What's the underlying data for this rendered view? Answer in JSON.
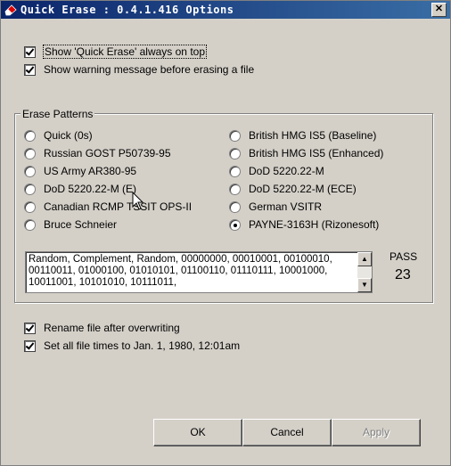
{
  "window": {
    "title": "Quick Erase : 0.4.1.416 Options",
    "close_glyph": "✕"
  },
  "options_top": [
    {
      "label": "Show 'Quick Erase' always on top",
      "checked": true
    },
    {
      "label": "Show warning message before erasing a file",
      "checked": true
    }
  ],
  "patterns": {
    "group_label": "Erase Patterns",
    "left": [
      "Quick (0s)",
      "Russian GOST P50739-95",
      "US Army AR380-95",
      "DoD 5220.22-M (E)",
      "Canadian RCMP TSSIT OPS-II",
      "Bruce Schneier"
    ],
    "right": [
      "British HMG IS5 (Baseline)",
      "British HMG IS5 (Enhanced)",
      "DoD 5220.22-M",
      "DoD 5220.22-M (ECE)",
      "German VSITR",
      "PAYNE-3163H (Rizonesoft)"
    ],
    "selected": "PAYNE-3163H (Rizonesoft)",
    "description": "Random, Complement, Random, 00000000, 00010001, 00100010, 00110011, 01000100, 01010101, 01100110, 01110111, 10001000, 10011001, 10101010, 10111011,",
    "pass_label": "PASS",
    "pass_value": "23"
  },
  "options_bottom": [
    {
      "label": "Rename file after overwriting",
      "checked": true
    },
    {
      "label": "Set all file times to Jan. 1, 1980, 12:01am",
      "checked": true
    }
  ],
  "buttons": {
    "ok": "OK",
    "cancel": "Cancel",
    "apply": "Apply"
  },
  "colors": {
    "title_bar": "#0a246a",
    "face": "#d4d0c8"
  }
}
